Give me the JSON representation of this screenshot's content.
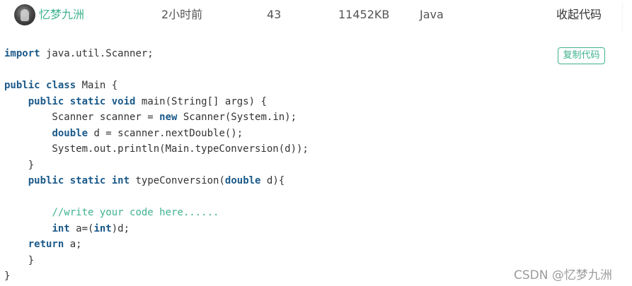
{
  "header": {
    "username": "忆梦九洲",
    "time": "2小时前",
    "score": "43",
    "memory": "11452KB",
    "language": "Java",
    "collapse_label": "收起代码",
    "avatar_icon": "user-avatar"
  },
  "code_block": {
    "copy_label": "复制代码",
    "keyword_color": "#1b5a8a",
    "comment_color": "#3fb28f",
    "lines": [
      [
        {
          "t": "import",
          "k": 1
        },
        {
          "t": " java.util.Scanner;"
        }
      ],
      [],
      [
        {
          "t": "public",
          "k": 1
        },
        {
          "t": " "
        },
        {
          "t": "class",
          "k": 1
        },
        {
          "t": " Main {"
        }
      ],
      [
        {
          "t": "    "
        },
        {
          "t": "public",
          "k": 1
        },
        {
          "t": " "
        },
        {
          "t": "static",
          "k": 1
        },
        {
          "t": " "
        },
        {
          "t": "void",
          "k": 1
        },
        {
          "t": " main(String[] args) {"
        }
      ],
      [
        {
          "t": "        Scanner scanner = "
        },
        {
          "t": "new",
          "k": 1
        },
        {
          "t": " Scanner(System.in);"
        }
      ],
      [
        {
          "t": "        "
        },
        {
          "t": "double",
          "k": 1
        },
        {
          "t": " d = scanner.nextDouble();"
        }
      ],
      [
        {
          "t": "        System.out.println(Main.typeConversion(d));"
        }
      ],
      [
        {
          "t": "    }"
        }
      ],
      [
        {
          "t": "    "
        },
        {
          "t": "public",
          "k": 1
        },
        {
          "t": " "
        },
        {
          "t": "static",
          "k": 1
        },
        {
          "t": " "
        },
        {
          "t": "int",
          "k": 1
        },
        {
          "t": " typeConversion("
        },
        {
          "t": "double",
          "k": 1
        },
        {
          "t": " d){"
        }
      ],
      [],
      [
        {
          "t": "        "
        },
        {
          "t": "//write your code here......",
          "c": 1
        }
      ],
      [
        {
          "t": "        "
        },
        {
          "t": "int",
          "k": 1
        },
        {
          "t": " a=("
        },
        {
          "t": "int",
          "k": 1
        },
        {
          "t": ")d;"
        }
      ],
      [
        {
          "t": "    "
        },
        {
          "t": "return",
          "k": 1
        },
        {
          "t": " a;"
        }
      ],
      [
        {
          "t": "    }"
        }
      ],
      [
        {
          "t": "}"
        }
      ]
    ]
  },
  "watermark": "CSDN @忆梦九洲"
}
